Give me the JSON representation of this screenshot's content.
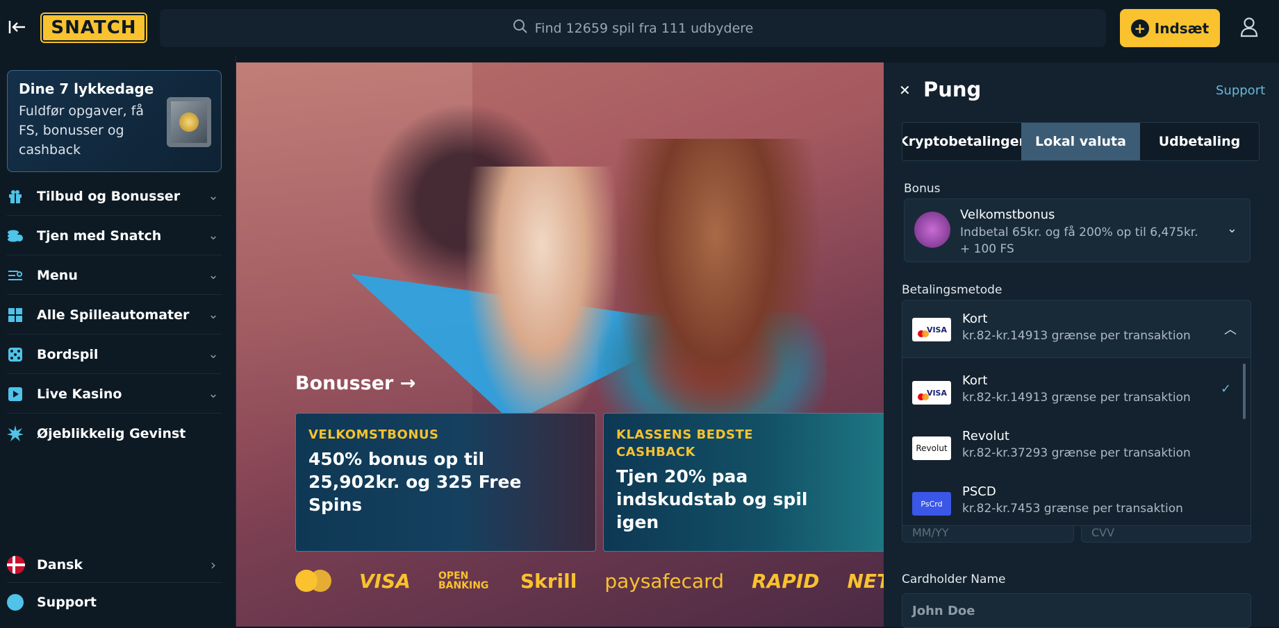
{
  "header": {
    "logo_text": "SNATCH",
    "search_placeholder": "Find 12659 spil fra 111 udbydere",
    "deposit_label": "Indsæt"
  },
  "sidebar": {
    "promo": {
      "title": "Dine 7 lykkedage",
      "text": "Fuldfør opgaver, få FS, bonusser og cashback"
    },
    "items": [
      {
        "label": "Tilbud og Bonusser",
        "icon": "gift-icon"
      },
      {
        "label": "Tjen med Snatch",
        "icon": "coins-icon"
      },
      {
        "label": "Menu",
        "icon": "menu-icon"
      },
      {
        "label": "Alle Spilleautomater",
        "icon": "grid-icon"
      },
      {
        "label": "Bordspil",
        "icon": "dice-icon"
      },
      {
        "label": "Live Kasino",
        "icon": "play-icon"
      },
      {
        "label": "Øjeblikkelig Gevinst",
        "icon": "burst-icon"
      }
    ],
    "language": "Dansk",
    "support": "Support"
  },
  "main": {
    "section_title": "Bonusser",
    "cards": [
      {
        "tag": "VELKOMSTBONUS",
        "text": "450% bonus op til 25,902kr. og 325 Free Spins"
      },
      {
        "tag": "KLASSENS BEDSTE CASHBACK",
        "text": "Tjen 20% paa indskudstab og spil igen"
      }
    ],
    "payments": [
      "VISA",
      "OPEN BANKING",
      "Skrill",
      "paysafecard",
      "RAPID",
      "NET"
    ]
  },
  "wallet": {
    "title": "Pung",
    "support": "Support",
    "tabs": [
      "Kryptobetalinger",
      "Lokal valuta",
      "Udbetaling"
    ],
    "active_tab": 1,
    "bonus_label": "Bonus",
    "bonus_name": "Velkomstbonus",
    "bonus_text": "Indbetal 65kr. og få 200% op til 6,475kr. + 100 FS",
    "method_label": "Betalingsmetode",
    "selected_method": {
      "name": "Kort",
      "limit": "kr.82-kr.14913 grænse per transaktion"
    },
    "methods": [
      {
        "name": "Kort",
        "limit": "kr.82-kr.14913 grænse per transaktion",
        "logo": "VISA",
        "selected": true
      },
      {
        "name": "Revolut",
        "limit": "kr.82-kr.37293 grænse per transaktion",
        "logo": "Revolut"
      },
      {
        "name": "PSCD",
        "limit": "kr.82-kr.7453 grænse per transaktion",
        "logo": "PsCrd"
      }
    ],
    "expiry_placeholder": "MM/YY",
    "cvv_placeholder": "CVV",
    "cardholder_label": "Cardholder Name",
    "cardholder_placeholder": "John Doe"
  },
  "colors": {
    "accent": "#f9c22e",
    "bg": "#0d1a24",
    "panel": "#13222e",
    "icon": "#4fc3e8"
  }
}
